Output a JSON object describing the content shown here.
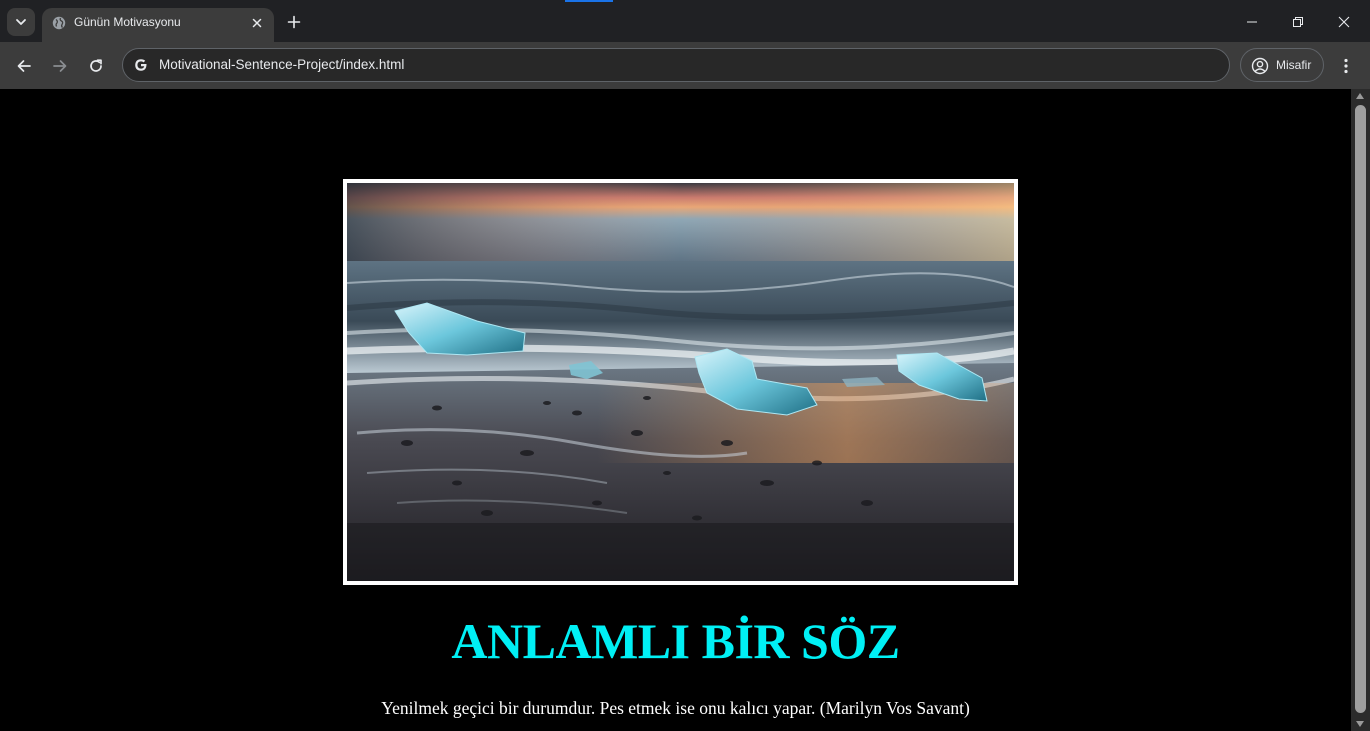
{
  "browser": {
    "tab": {
      "title": "Günün Motivasyonu"
    },
    "address_bar": {
      "url": "Motivational-Sentence-Project/index.html"
    },
    "profile": {
      "label": "Misafir"
    },
    "icons": {
      "tab_search": "chevron-down-icon",
      "favicon": "globe-icon",
      "tab_close": "close-icon",
      "new_tab": "plus-icon",
      "minimize": "minimize-icon",
      "restore": "restore-icon",
      "close_window": "close-icon",
      "back": "arrow-left-icon",
      "forward": "arrow-right-icon",
      "reload": "reload-icon",
      "site_info": "google-g-icon",
      "profile": "person-circle-icon",
      "menu": "kebab-menu-icon"
    },
    "accent_color": "#1a73e8"
  },
  "page": {
    "background": "#000000",
    "heading": "ANLAMLI BİR SÖZ",
    "heading_color": "#00f0f5",
    "quote": "Yenilmek geçici bir durumdur. Pes etmek ise onu kalıcı yapar. (Marilyn Vos Savant)",
    "image": {
      "subject": "ice-chunks-on-black-sand-beach-at-sunset",
      "border_color": "#ffffff"
    }
  }
}
